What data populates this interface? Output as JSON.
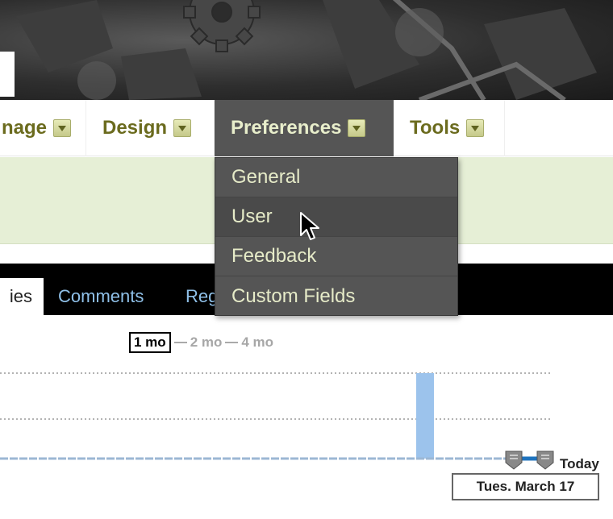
{
  "nav": {
    "items": [
      {
        "label": "nage"
      },
      {
        "label": "Design"
      },
      {
        "label": "Preferences"
      },
      {
        "label": "Tools"
      }
    ]
  },
  "dropdown": {
    "items": [
      {
        "label": "General"
      },
      {
        "label": "User"
      },
      {
        "label": "Feedback"
      },
      {
        "label": "Custom Fields"
      }
    ],
    "hovered_index": 1
  },
  "tabs": {
    "items": [
      {
        "label": "ies"
      },
      {
        "label": "Comments"
      },
      {
        "label": "Reg"
      }
    ]
  },
  "range": {
    "options": [
      {
        "label": "1 mo"
      },
      {
        "label": "2 mo"
      },
      {
        "label": "4 mo"
      }
    ],
    "active": "1 mo"
  },
  "chart": {
    "today_label": "Today",
    "selected_date": "Tues. March 17"
  },
  "colors": {
    "nav_text": "#6b6b1e",
    "menu_bg": "#555555",
    "menu_text": "#e6ebc8",
    "green_panel": "#e6efd6",
    "tab_link": "#8fc0e8",
    "bar": "#9cc3ec"
  }
}
